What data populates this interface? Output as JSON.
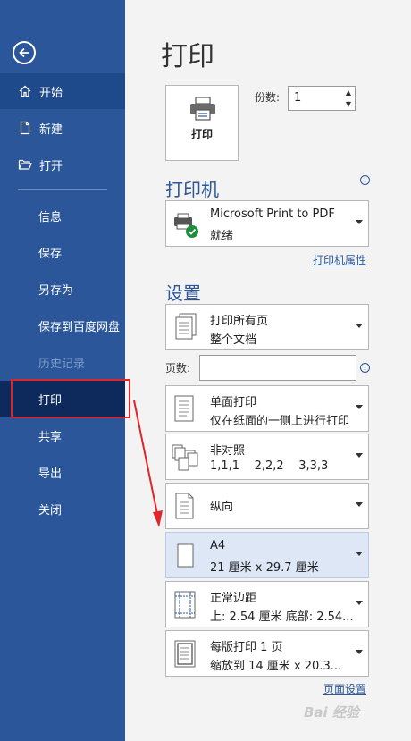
{
  "sidebar": {
    "items": [
      {
        "key": "home",
        "label": "开始"
      },
      {
        "key": "new",
        "label": "新建"
      },
      {
        "key": "open",
        "label": "打开"
      },
      {
        "key": "info",
        "label": "信息"
      },
      {
        "key": "save",
        "label": "保存"
      },
      {
        "key": "saveas",
        "label": "另存为"
      },
      {
        "key": "savebaidu",
        "label": "保存到百度网盘"
      },
      {
        "key": "history",
        "label": "历史记录"
      },
      {
        "key": "print",
        "label": "打印"
      },
      {
        "key": "share",
        "label": "共享"
      },
      {
        "key": "export",
        "label": "导出"
      },
      {
        "key": "close",
        "label": "关闭"
      }
    ]
  },
  "main": {
    "title": "打印",
    "print_button": "打印",
    "copies": {
      "label": "份数:",
      "value": "1"
    },
    "printer": {
      "section_title": "打印机",
      "name": "Microsoft Print to PDF",
      "status": "就绪",
      "properties_link": "打印机属性"
    },
    "settings": {
      "section_title": "设置",
      "pages_label": "页数:",
      "pages_value": "",
      "dropdowns": [
        {
          "line1": "打印所有页",
          "line2": "整个文档",
          "icon": "pages-icon"
        },
        {
          "line1": "单面打印",
          "line2": "仅在纸面的一侧上进行打印",
          "icon": "single-sided-icon"
        },
        {
          "line1": "非对照",
          "line2": "1,1,1    2,2,2    3,3,3",
          "icon": "collate-icon"
        },
        {
          "line1": "纵向",
          "line2": "",
          "icon": "portrait-icon"
        },
        {
          "line1": "A4",
          "line2": "21 厘米 x 29.7 厘米",
          "icon": "paper-size-icon"
        },
        {
          "line1": "正常边距",
          "line2": "上: 2.54 厘米 底部: 2.54...",
          "icon": "margins-icon"
        },
        {
          "line1": "每版打印 1 页",
          "line2": "缩放到 14 厘米 x 20.3...",
          "icon": "pages-per-sheet-icon"
        }
      ],
      "page_setup_link": "页面设置"
    }
  },
  "watermark": "Bai 经验",
  "colors": {
    "sidebar": "#2b579a",
    "accent": "#2b579a",
    "highlight": "#e0262a"
  }
}
